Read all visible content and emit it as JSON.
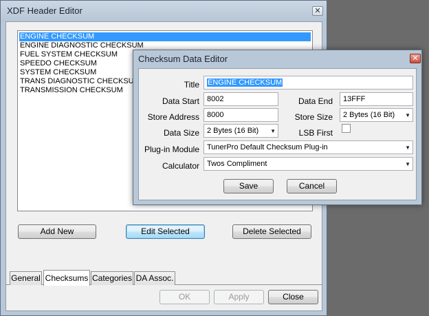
{
  "xdf_editor": {
    "title": "XDF Header Editor",
    "checksums": [
      {
        "label": "ENGINE CHECKSUM",
        "selected": true
      },
      {
        "label": "ENGINE DIAGNOSTIC CHECKSUM",
        "selected": false
      },
      {
        "label": "FUEL SYSTEM CHECKSUM",
        "selected": false
      },
      {
        "label": "SPEEDO CHECKSUM",
        "selected": false
      },
      {
        "label": "SYSTEM CHECKSUM",
        "selected": false
      },
      {
        "label": "TRANS DIAGNOSTIC CHECKSUM",
        "selected": false
      },
      {
        "label": "TRANSMISSION CHECKSUM",
        "selected": false
      }
    ],
    "add_new_label": "Add New",
    "edit_selected_label": "Edit Selected",
    "delete_selected_label": "Delete Selected",
    "tabs": [
      {
        "label": "General",
        "active": false
      },
      {
        "label": "Checksums",
        "active": true
      },
      {
        "label": "Categories",
        "active": false
      },
      {
        "label": "DA Assoc.",
        "active": false
      }
    ],
    "ok_label": "OK",
    "apply_label": "Apply",
    "close_label": "Close"
  },
  "checksum_editor": {
    "title": "Checksum Data Editor",
    "title_label": "Title",
    "title_value": "ENGINE CHECKSUM",
    "data_start_label": "Data Start",
    "data_start_value": "8002",
    "data_end_label": "Data End",
    "data_end_value": "13FFF",
    "store_address_label": "Store Address",
    "store_address_value": "8000",
    "store_size_label": "Store Size",
    "store_size_value": "2 Bytes (16 Bit)",
    "data_size_label": "Data Size",
    "data_size_value": "2 Bytes (16 Bit)",
    "lsb_first_label": "LSB First",
    "lsb_first_checked": false,
    "plugin_module_label": "Plug-in Module",
    "plugin_module_value": "TunerPro Default Checksum Plug-in",
    "calculator_label": "Calculator",
    "calculator_value": "Twos Compliment",
    "save_label": "Save",
    "cancel_label": "Cancel"
  },
  "colors": {
    "selection": "#3399ff",
    "frame": "#b9c8d8",
    "close_red": "#c7503b"
  }
}
